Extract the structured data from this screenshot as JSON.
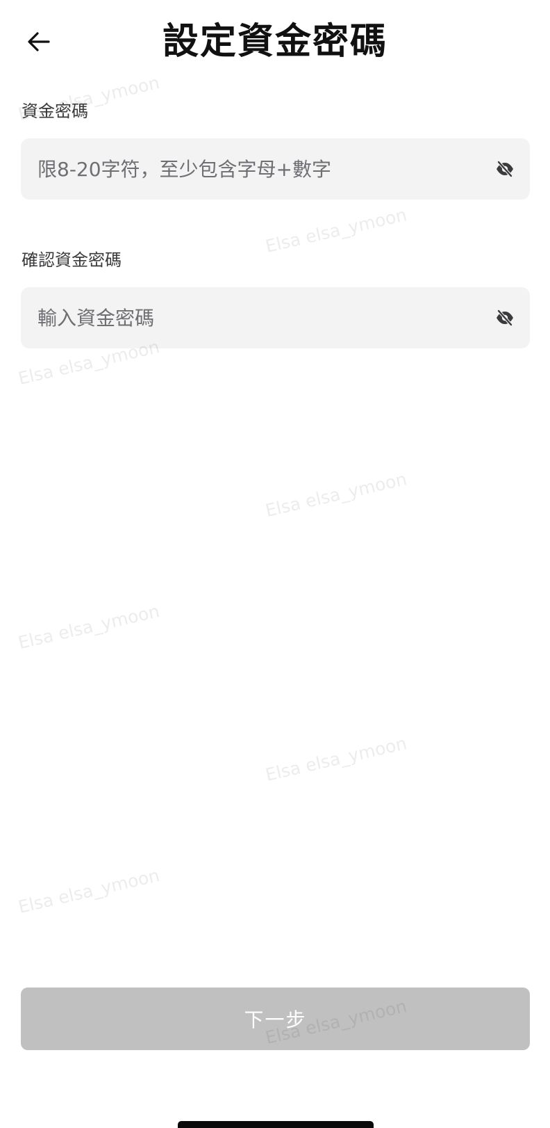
{
  "header": {
    "back_icon": "arrow-left-icon",
    "title": "設定資金密碼"
  },
  "fund_password": {
    "label": "資金密碼",
    "value": "",
    "placeholder": "限8-20字符，至少包含字母+數字",
    "visibility_icon": "eye-off-icon"
  },
  "confirm_password": {
    "label": "確認資金密碼",
    "value": "",
    "placeholder": "輸入資金密碼",
    "visibility_icon": "eye-off-icon"
  },
  "next_button": {
    "label": "下一步",
    "state": "disabled"
  },
  "watermark": {
    "text": "Elsa elsa_ymoon"
  },
  "colors": {
    "input_background": "#f3f3f3",
    "button_disabled": "#c0c0c0",
    "title_text": "#111111",
    "label_text": "#3a3a3c",
    "placeholder_text": "#6e6e73"
  }
}
